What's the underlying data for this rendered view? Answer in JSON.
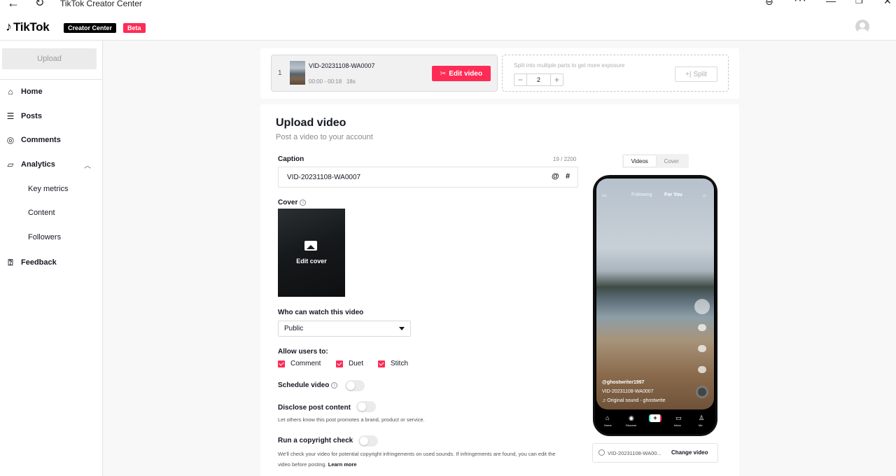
{
  "window": {
    "title": "TikTok Creator Center"
  },
  "header": {
    "logo_text": "TikTok",
    "creator_center_badge": "Creator Center",
    "beta_badge": "Beta"
  },
  "sidebar": {
    "upload_label": "Upload",
    "items": [
      {
        "label": "Home",
        "icon": "home-icon"
      },
      {
        "label": "Posts",
        "icon": "list-icon"
      },
      {
        "label": "Comments",
        "icon": "comment-icon"
      },
      {
        "label": "Analytics",
        "icon": "analytics-icon"
      },
      {
        "label": "Feedback",
        "icon": "feedback-icon"
      }
    ],
    "analytics_sub": [
      "Key metrics",
      "Content",
      "Followers"
    ]
  },
  "split_card": {
    "index": "1",
    "video_name": "VID-20231108-WA0007",
    "time_range": "00:00 - 00:18",
    "duration": "18s",
    "edit_label": "Edit video",
    "split_hint": "Split into multiple parts to get more exposure",
    "split_count": "2",
    "split_label": "Split"
  },
  "upload": {
    "title": "Upload video",
    "subtitle": "Post a video to your account",
    "caption_label": "Caption",
    "caption_counter": "19 / 2200",
    "caption_value": "VID-20231108-WA0007",
    "mention_symbol": "@",
    "hashtag_symbol": "#",
    "cover_label": "Cover",
    "edit_cover_label": "Edit cover",
    "who_can_watch_label": "Who can watch this video",
    "visibility_value": "Public",
    "allow_users_label": "Allow users to:",
    "allow_options": [
      "Comment",
      "Duet",
      "Stitch"
    ],
    "schedule_label": "Schedule video",
    "disclose_label": "Disclose post content",
    "disclose_desc": "Let others know this post promotes a brand, product or service.",
    "copyright_label": "Run a copyright check",
    "copyright_desc": "We'll check your video for potential copyright infringements on used sounds. If infringements are found, you can edit the",
    "copyright_desc2": "video before posting.",
    "learn_more": "Learn more"
  },
  "preview": {
    "tab_videos": "Videos",
    "tab_cover": "Cover",
    "nav_following": "Following",
    "nav_foryou": "For You",
    "username": "@ghostwriter1997",
    "video_name": "VID-20231108-WA0007",
    "sound": "Original sound - ghostwrite",
    "bottom_items": [
      "Home",
      "Discover",
      "Inbox",
      "Me"
    ],
    "file_name": "VID-20231108-WA00...",
    "change_video_label": "Change video"
  },
  "colors": {
    "accent": "#fe2c55",
    "text": "#161823",
    "muted": "#8a8a90"
  }
}
